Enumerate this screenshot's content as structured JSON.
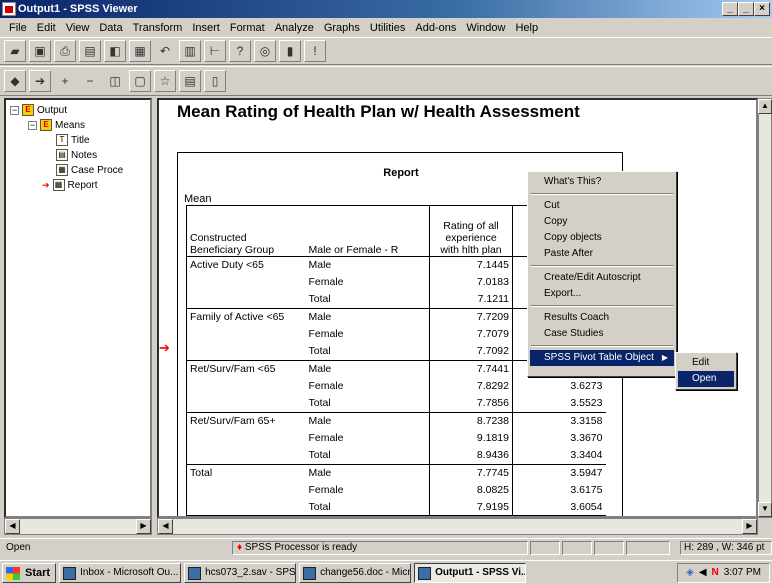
{
  "window": {
    "title": "Output1 - SPSS Viewer",
    "controls": [
      "_",
      "̲",
      "×"
    ]
  },
  "menu": [
    "File",
    "Edit",
    "View",
    "Data",
    "Transform",
    "Insert",
    "Format",
    "Analyze",
    "Graphs",
    "Utilities",
    "Add-ons",
    "Window",
    "Help"
  ],
  "outline": {
    "root": "Output",
    "means": "Means",
    "title": "Title",
    "notes": "Notes",
    "case": "Case Proce",
    "report": "Report"
  },
  "content": {
    "heading": "Mean Rating of Health Plan w/ Health Assessment"
  },
  "pivot": {
    "title": "Report",
    "stat": "Mean",
    "headers": {
      "group": [
        "Constructed",
        "Beneficiary Group"
      ],
      "sex": "Male or Female  - R",
      "rating": [
        "Rating of all",
        "experience",
        "with hlth plan"
      ]
    },
    "groups": [
      {
        "name": "Active Duty <65",
        "rows": [
          [
            "Male",
            "7.1445",
            ""
          ],
          [
            "Female",
            "7.0183",
            ""
          ],
          [
            "Total",
            "7.1211",
            ""
          ]
        ]
      },
      {
        "name": "Family of Active <65",
        "rows": [
          [
            "Male",
            "7.7209",
            ""
          ],
          [
            "Female",
            "7.7079",
            ""
          ],
          [
            "Total",
            "7.7092",
            ""
          ]
        ]
      },
      {
        "name": "Ret/Surv/Fam <65",
        "rows": [
          [
            "Male",
            "7.7441",
            ""
          ],
          [
            "Female",
            "7.8292",
            "3.6273"
          ],
          [
            "Total",
            "7.7856",
            "3.5523"
          ]
        ]
      },
      {
        "name": "Ret/Surv/Fam 65+",
        "rows": [
          [
            "Male",
            "8.7238",
            "3.3158"
          ],
          [
            "Female",
            "9.1819",
            "3.3670"
          ],
          [
            "Total",
            "8.9436",
            "3.3404"
          ]
        ]
      },
      {
        "name": "Total",
        "rows": [
          [
            "Male",
            "7.7745",
            "3.5947"
          ],
          [
            "Female",
            "8.0825",
            "3.6175"
          ],
          [
            "Total",
            "7.9195",
            "3.6054"
          ]
        ]
      }
    ]
  },
  "context_menu": {
    "items": [
      "What's This?",
      "Cut",
      "Copy",
      "Copy objects",
      "Paste After",
      "Create/Edit Autoscript",
      "Export...",
      "Results Coach",
      "Case Studies",
      "SPSS Pivot Table Object"
    ]
  },
  "submenu": {
    "items": [
      "Edit",
      "Open"
    ]
  },
  "status": {
    "left": "Open",
    "processor": "SPSS Processor  is ready",
    "dims": "H: 289 , W: 346  pt"
  },
  "taskbar": {
    "start": "Start",
    "tasks": [
      "Inbox - Microsoft Ou...",
      "hcs073_2.sav - SPS...",
      "change56.doc - Micr...",
      "Output1 - SPSS Vi..."
    ],
    "clock": "3:07 PM"
  }
}
